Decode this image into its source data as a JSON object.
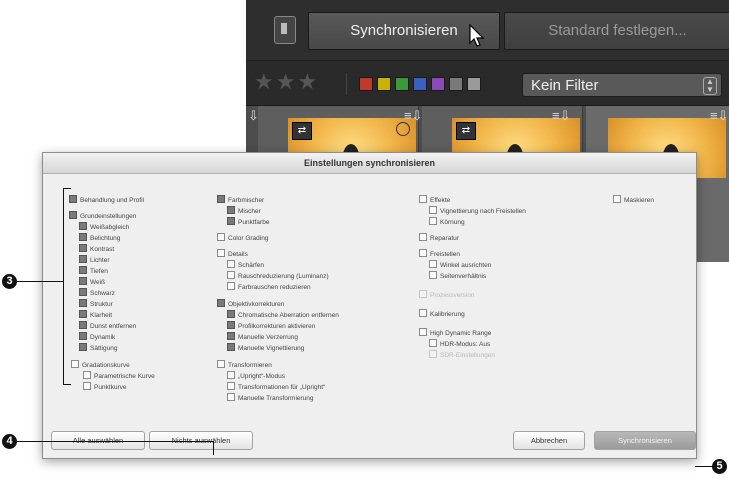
{
  "toolbar": {
    "sync_label": "Synchronisieren",
    "default_label": "Standard festlegen..."
  },
  "filter": {
    "stars": "★★★",
    "colors": [
      "#c0392b",
      "#c8b400",
      "#3a9a3a",
      "#3b5fc0",
      "#8a4ab8",
      "#7a7a7a",
      "#9a9a9a"
    ],
    "selected": "Kein Filter"
  },
  "dialog": {
    "title": "Einstellungen synchronisieren",
    "col1": [
      {
        "label": "Behandlung und Profil",
        "checked": true
      },
      {
        "label": "Grundeinstellungen",
        "checked": true
      },
      {
        "label": "Weißabgleich",
        "checked": true
      },
      {
        "label": "Belichtung",
        "checked": true
      },
      {
        "label": "Kontrast",
        "checked": true
      },
      {
        "label": "Lichter",
        "checked": true
      },
      {
        "label": "Tiefen",
        "checked": true
      },
      {
        "label": "Weiß",
        "checked": true
      },
      {
        "label": "Schwarz",
        "checked": true
      },
      {
        "label": "Struktur",
        "checked": true
      },
      {
        "label": "Klarheit",
        "checked": true
      },
      {
        "label": "Dunst entfernen",
        "checked": true
      },
      {
        "label": "Dynamik",
        "checked": true
      },
      {
        "label": "Sättigung",
        "checked": true
      },
      {
        "label": "Gradationskurve",
        "checked": false
      },
      {
        "label": "Parametrische Kurve",
        "checked": false
      },
      {
        "label": "Punktkurve",
        "checked": false
      }
    ],
    "col2": [
      {
        "label": "Farbmischer",
        "checked": true
      },
      {
        "label": "Mischer",
        "checked": true
      },
      {
        "label": "Punktfarbe",
        "checked": true
      },
      {
        "label": "Color Grading",
        "checked": false
      },
      {
        "label": "Details",
        "checked": false
      },
      {
        "label": "Schärfen",
        "checked": false
      },
      {
        "label": "Rauschreduzierung (Luminanz)",
        "checked": false
      },
      {
        "label": "Farbrauschen reduzieren",
        "checked": false
      },
      {
        "label": "Objektivkorrekturen",
        "checked": true
      },
      {
        "label": "Chromatische Aberration entfernen",
        "checked": true
      },
      {
        "label": "Profilkorrekturen aktivieren",
        "checked": true
      },
      {
        "label": "Manuelle Verzerrung",
        "checked": true
      },
      {
        "label": "Manuelle Vignettierung",
        "checked": true
      },
      {
        "label": "Transformieren",
        "checked": false
      },
      {
        "label": "„Upright“-Modus",
        "checked": false
      },
      {
        "label": "Transformationen für „Upright“",
        "checked": false
      },
      {
        "label": "Manuelle Transformierung",
        "checked": false
      }
    ],
    "col3": [
      {
        "label": "Effekte",
        "checked": false
      },
      {
        "label": "Vignettierung nach Freistellen",
        "checked": false
      },
      {
        "label": "Körnung",
        "checked": false
      },
      {
        "label": "Reparatur",
        "checked": false
      },
      {
        "label": "Freistellen",
        "checked": false
      },
      {
        "label": "Winkel ausrichten",
        "checked": false
      },
      {
        "label": "Seitenverhältnis",
        "checked": false
      },
      {
        "label": "Prozessversion",
        "checked": false
      },
      {
        "label": "Kalibrierung",
        "checked": false
      },
      {
        "label": "High Dynamic Range",
        "checked": false
      },
      {
        "label": "HDR-Modus: Aus",
        "checked": false
      },
      {
        "label": "SDR-Einstellungen",
        "checked": false
      }
    ],
    "col4": [
      {
        "label": "Maskieren",
        "checked": false
      }
    ],
    "buttons": {
      "select_all": "Alle auswählen",
      "select_none": "Nichts auswählen",
      "cancel": "Abbrechen",
      "sync": "Synchronisieren"
    }
  },
  "callouts": {
    "c3": "3",
    "c4": "4",
    "c5": "5"
  }
}
